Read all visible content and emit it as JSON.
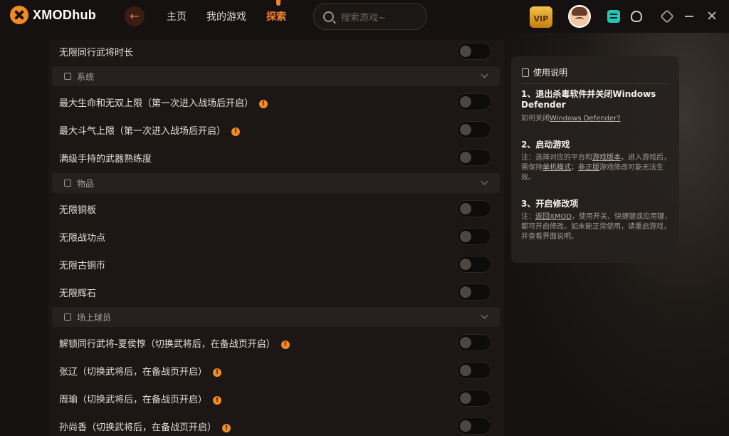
{
  "app": {
    "brand": "XMODhub",
    "back_glyph": "←"
  },
  "nav": {
    "items": [
      "主页",
      "我的游戏",
      "探索"
    ],
    "active_index": 2
  },
  "search": {
    "placeholder": "搜索游戏~"
  },
  "vip": {
    "label": "VIP"
  },
  "colors": {
    "accent": "#f3842a",
    "panel": "#1c1715",
    "section_bg": "#262120",
    "toggle_off": "#0e0c0b"
  },
  "list": {
    "top_row": {
      "label": "无限同行武将时长",
      "enabled": false
    },
    "sections": [
      {
        "label": "系统",
        "icon": "grid-icon",
        "items": [
          {
            "label": "最大生命和无双上限（第一次进入战场后开启）",
            "info": true,
            "enabled": false
          },
          {
            "label": "最大斗气上限（第一次进入战场后开启）",
            "info": true,
            "enabled": false
          },
          {
            "label": "满级手持的武器熟练度",
            "info": false,
            "enabled": false
          }
        ]
      },
      {
        "label": "物品",
        "icon": "box-icon",
        "items": [
          {
            "label": "无限铜板",
            "info": false,
            "enabled": false
          },
          {
            "label": "无限战功点",
            "info": false,
            "enabled": false
          },
          {
            "label": "无限古铜币",
            "info": false,
            "enabled": false
          },
          {
            "label": "无限辉石",
            "info": false,
            "enabled": false
          }
        ]
      },
      {
        "label": "场上球员",
        "icon": "grid-icon",
        "items": [
          {
            "label": "解锁同行武将-夏侯惇（切换武将后，在备战页开启）",
            "info": true,
            "enabled": false
          },
          {
            "label": "张辽（切换武将后，在备战页开启）",
            "info": true,
            "enabled": false
          },
          {
            "label": "周瑜（切换武将后，在备战页开启）",
            "info": true,
            "enabled": false
          },
          {
            "label": "孙尚香（切换武将后，在备战页开启）",
            "info": true,
            "enabled": false
          }
        ]
      }
    ],
    "info_glyph": "!"
  },
  "help": {
    "title": "使用说明",
    "step1": {
      "title": "1、退出杀毒软件并关闭Windows Defender",
      "note_prefix": "如何关闭",
      "note_link": "Windows Defender?"
    },
    "step2": {
      "title": "2、启动游戏",
      "note_a": "注：选择对应的平台和",
      "note_link1": "游戏版本",
      "note_b": "，进入游戏后，需保持",
      "note_link2": "单机模式",
      "note_c": "；",
      "note_link3": "非正版",
      "note_d": "游戏修改可能无法生效。"
    },
    "step3": {
      "title": "3、开启修改项",
      "note_a": "注：",
      "note_link": "返回XMOD",
      "note_b": "，使用开关、快捷键或应用键，都可开启修改。如未能正常使用，请重启游戏，并查看界面说明。"
    }
  }
}
